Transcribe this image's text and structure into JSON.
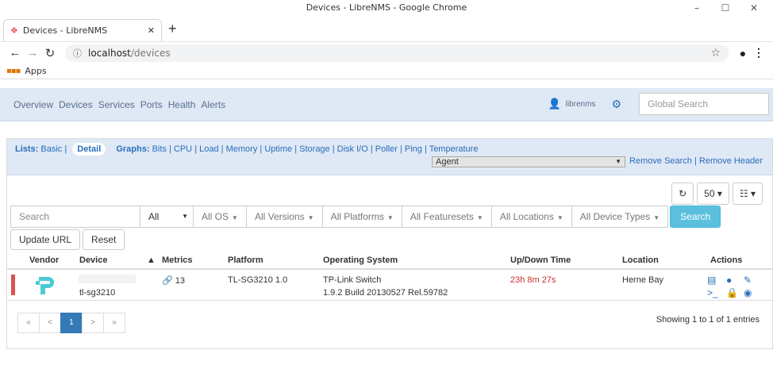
{
  "window": {
    "title": "Devices - LibreNMS - Google Chrome",
    "min": "–",
    "max": "☐",
    "close": "✕"
  },
  "tab": {
    "title": "Devices - LibreNMS",
    "close": "✕",
    "new": "+"
  },
  "address": {
    "host": "localhost",
    "path": "/devices"
  },
  "bookmarks": {
    "apps": "Apps"
  },
  "nav": {
    "items": [
      "Overview",
      "Devices",
      "Services",
      "Ports",
      "Health",
      "Alerts"
    ],
    "user": "librenms",
    "search_placeholder": "Global Search"
  },
  "heading": {
    "lists_label": "Lists:",
    "basic": "Basic",
    "detail": "Detail",
    "graphs_label": "Graphs:",
    "graphs": [
      "Bits",
      "CPU",
      "Load",
      "Memory",
      "Uptime",
      "Storage",
      "Disk I/O",
      "Poller",
      "Ping",
      "Temperature"
    ],
    "agent": "Agent",
    "remove_search": "Remove Search",
    "remove_header": "Remove Header"
  },
  "toolbar": {
    "refresh": "↻",
    "page_size": "50 ▾",
    "view": "☷ ▾"
  },
  "filters": {
    "search_placeholder": "Search",
    "all": "All",
    "os": "All OS",
    "versions": "All Versions",
    "platforms": "All Platforms",
    "featuresets": "All Featuresets",
    "locations": "All Locations",
    "device_types": "All Device Types",
    "search_button": "Search"
  },
  "buttons": {
    "update_url": "Update URL",
    "reset": "Reset"
  },
  "table": {
    "headers": {
      "vendor": "Vendor",
      "device": "Device",
      "metrics": "Metrics",
      "platform": "Platform",
      "os": "Operating System",
      "uptime": "Up/Down Time",
      "location": "Location",
      "actions": "Actions"
    },
    "rows": [
      {
        "device": "tl-sg3210",
        "metrics": "13",
        "platform": "TL-SG3210 1.0",
        "os_name": "TP-Link Switch",
        "os_version": "1.9.2 Build 20130527 Rel.59782",
        "uptime": "23h 8m 27s",
        "location": "Herne Bay"
      }
    ]
  },
  "pagination": {
    "first": "«",
    "prev": "<",
    "current": "1",
    "next": ">",
    "last": "»",
    "showing": "Showing 1 to 1 of 1 entries"
  }
}
